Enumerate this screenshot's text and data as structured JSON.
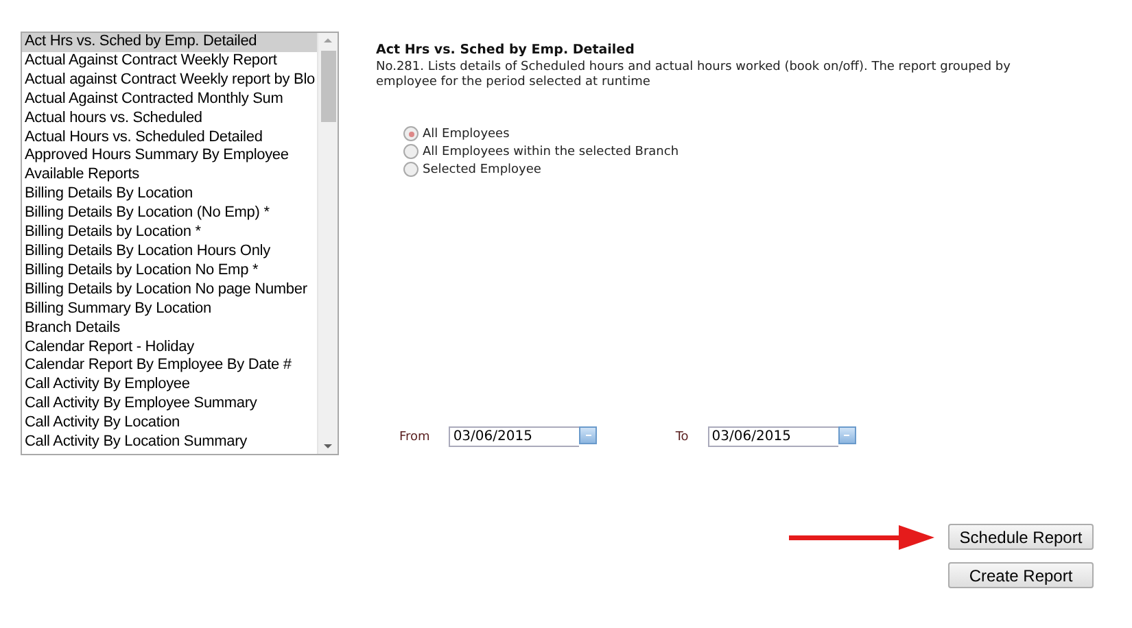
{
  "report_list": {
    "items": [
      {
        "label": "Act Hrs vs. Sched by Emp. Detailed",
        "selected": true
      },
      {
        "label": "Actual Against Contract Weekly Report",
        "selected": false
      },
      {
        "label": "Actual against Contract Weekly report by Blo",
        "selected": false
      },
      {
        "label": "Actual Against Contracted Monthly Sum",
        "selected": false
      },
      {
        "label": "Actual hours vs. Scheduled",
        "selected": false
      },
      {
        "label": "Actual Hours vs. Scheduled Detailed",
        "selected": false
      },
      {
        "label": "Approved Hours Summary By Employee",
        "selected": false
      },
      {
        "label": "Available Reports",
        "selected": false
      },
      {
        "label": "Billing Details By Location",
        "selected": false
      },
      {
        "label": "Billing Details By Location (No Emp) *",
        "selected": false
      },
      {
        "label": "Billing Details by Location *",
        "selected": false
      },
      {
        "label": "Billing Details By Location Hours Only",
        "selected": false
      },
      {
        "label": "Billing Details by Location No Emp *",
        "selected": false
      },
      {
        "label": "Billing Details by Location No page Number",
        "selected": false
      },
      {
        "label": "Billing Summary By Location",
        "selected": false
      },
      {
        "label": "Branch Details",
        "selected": false
      },
      {
        "label": "Calendar Report - Holiday",
        "selected": false
      },
      {
        "label": "Calendar Report By Employee By Date #",
        "selected": false
      },
      {
        "label": "Call Activity By Employee",
        "selected": false
      },
      {
        "label": "Call Activity By Employee Summary",
        "selected": false
      },
      {
        "label": "Call Activity By Location",
        "selected": false
      },
      {
        "label": "Call Activity By Location Summary",
        "selected": false
      }
    ]
  },
  "report": {
    "title": "Act Hrs vs. Sched by Emp. Detailed",
    "description": "No.281. Lists details of Scheduled hours and actual hours worked (book on/off). The report grouped by employee for the period selected at runtime"
  },
  "employee_options": [
    {
      "label": "All Employees",
      "selected": true
    },
    {
      "label": "All Employees within the selected Branch",
      "selected": false
    },
    {
      "label": "Selected Employee",
      "selected": false
    }
  ],
  "dates": [
    {
      "label": "From",
      "value": "03/06/2015"
    },
    {
      "label": "To",
      "value": "03/06/2015"
    }
  ],
  "buttons": [
    "Schedule Report",
    "Create Report"
  ]
}
